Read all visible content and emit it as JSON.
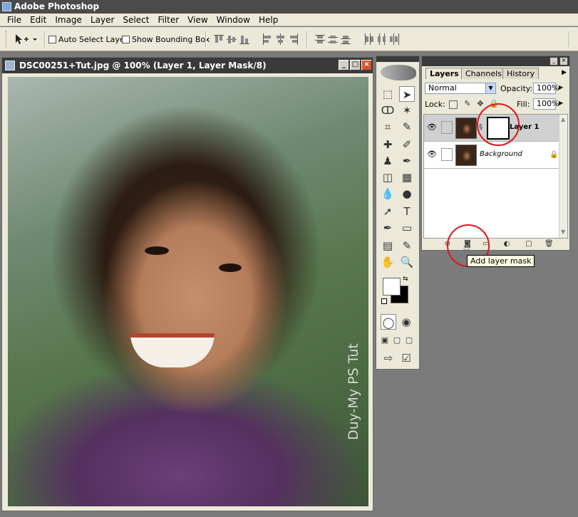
{
  "app": {
    "title": "Adobe Photoshop",
    "logo_icon": "photoshop-logo-icon"
  },
  "menu": [
    "File",
    "Edit",
    "Image",
    "Layer",
    "Select",
    "Filter",
    "View",
    "Window",
    "Help"
  ],
  "options": {
    "auto_select_layer": "Auto Select Layer",
    "show_bounding_box": "Show Bounding Box",
    "auto_select_checked": false,
    "bounding_box_checked": false
  },
  "document": {
    "title": "DSC00251+Tut.jpg @ 100% (Layer 1, Layer Mask/8)",
    "watermark": "Duy-My PS Tut",
    "buttons": {
      "minimize": "_",
      "maximize": "□",
      "close": "×"
    }
  },
  "layers_panel": {
    "tabs": [
      "Layers",
      "Channels",
      "History"
    ],
    "active_tab": "Layers",
    "blend_mode": "Normal",
    "opacity_label": "Opacity:",
    "opacity": "100%",
    "lock_label": "Lock:",
    "fill_label": "Fill:",
    "fill": "100%",
    "layers": [
      {
        "name": "Layer 1",
        "selected": true,
        "has_mask": true
      },
      {
        "name": "Background",
        "selected": false,
        "locked": true
      }
    ]
  },
  "tooltip": "Add layer mask",
  "highlight_color": "#e0141b"
}
